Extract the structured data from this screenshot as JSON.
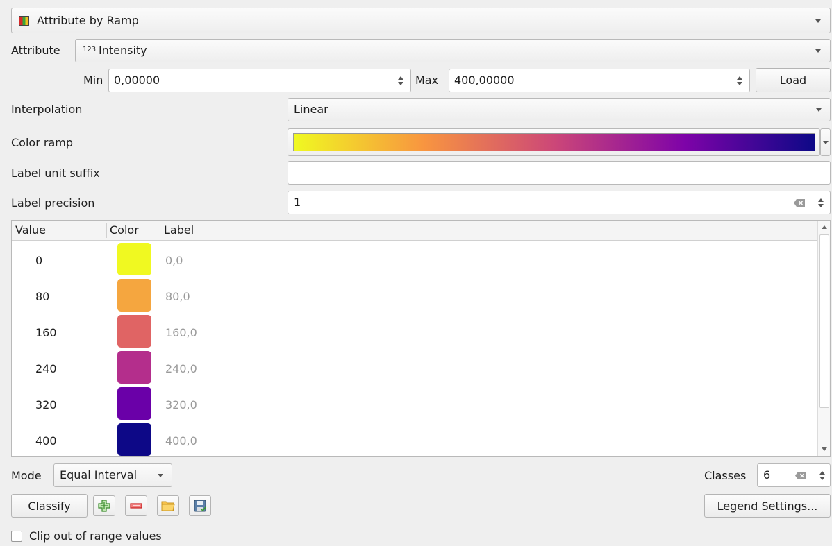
{
  "renderer": {
    "label": "Attribute by Ramp"
  },
  "attribute": {
    "label": "Attribute",
    "type_badge": "123",
    "value": "Intensity"
  },
  "range": {
    "min_label": "Min",
    "min_value": "0,00000",
    "max_label": "Max",
    "max_value": "400,00000",
    "load_label": "Load"
  },
  "interpolation": {
    "label": "Interpolation",
    "value": "Linear"
  },
  "color_ramp": {
    "label": "Color ramp",
    "colors": [
      "#f0f921",
      "#f89540",
      "#cc4778",
      "#7e03a8",
      "#0d0887"
    ]
  },
  "label_unit_suffix": {
    "label": "Label unit suffix",
    "value": ""
  },
  "label_precision": {
    "label": "Label precision",
    "value": "1"
  },
  "table": {
    "headers": [
      "Value",
      "Color",
      "Label"
    ],
    "rows": [
      {
        "value": "0",
        "color": "#f0f921",
        "label": "0,0"
      },
      {
        "value": "80",
        "color": "#f5a63f",
        "label": "80,0"
      },
      {
        "value": "160",
        "color": "#e06464",
        "label": "160,0"
      },
      {
        "value": "240",
        "color": "#b42e8c",
        "label": "240,0"
      },
      {
        "value": "320",
        "color": "#6a00a8",
        "label": "320,0"
      },
      {
        "value": "400",
        "color": "#0d0887",
        "label": "400,0"
      }
    ]
  },
  "mode": {
    "label": "Mode",
    "value": "Equal Interval"
  },
  "classes": {
    "label": "Classes",
    "value": "6"
  },
  "buttons": {
    "classify": "Classify",
    "legend_settings": "Legend Settings..."
  },
  "clip": {
    "label": "Clip out of range values",
    "checked": false
  }
}
